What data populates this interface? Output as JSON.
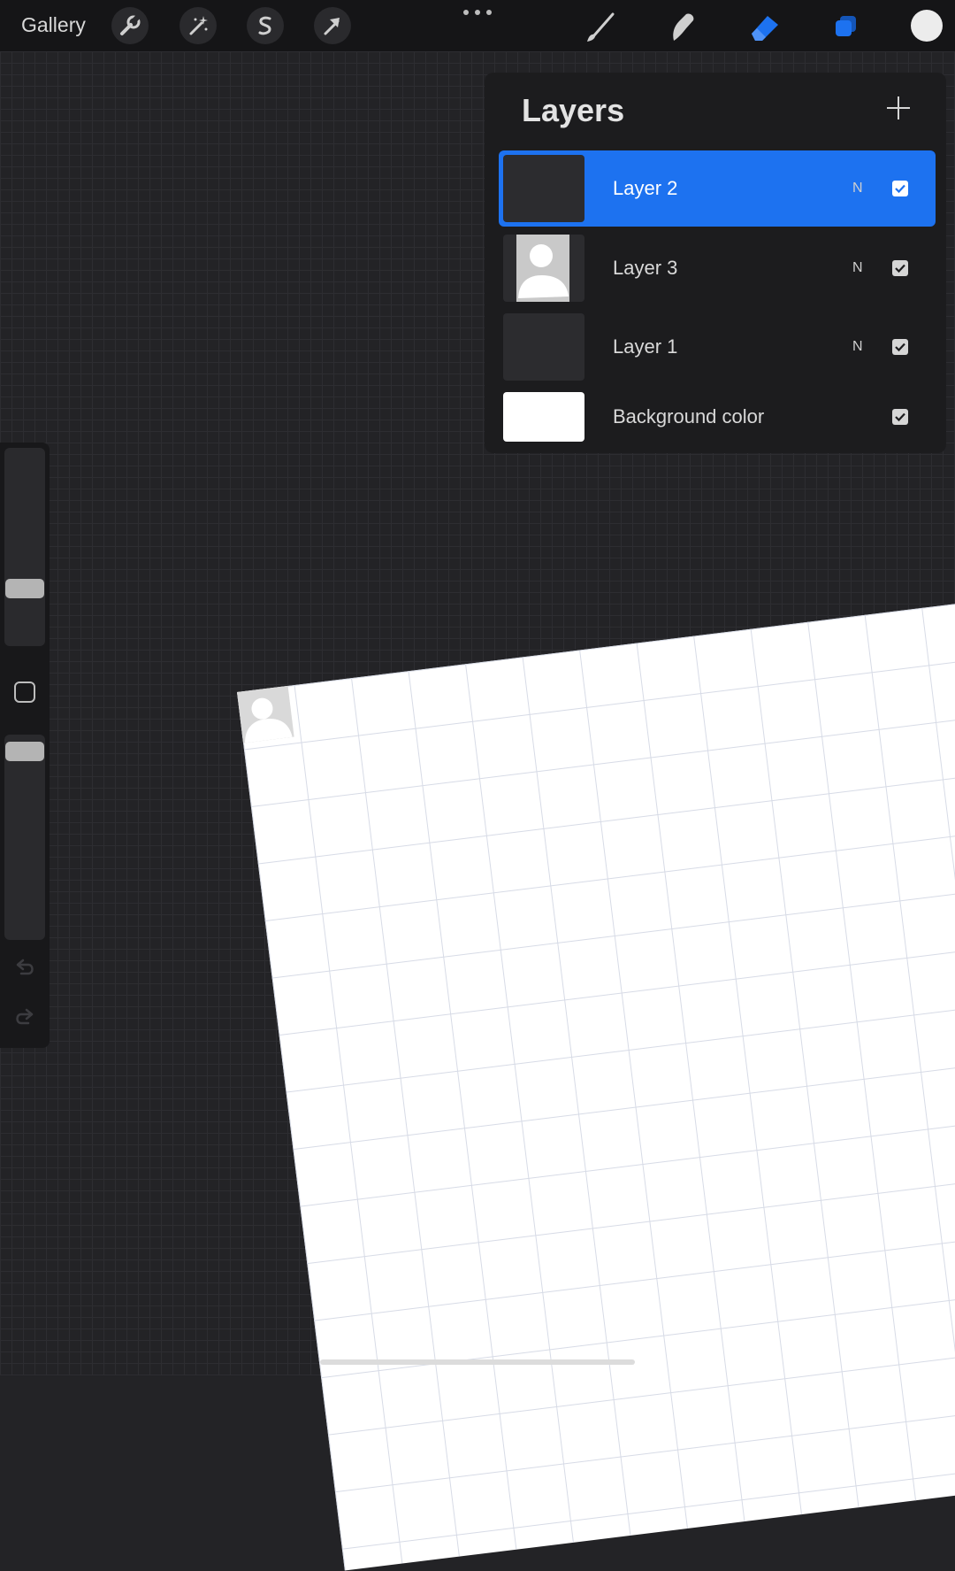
{
  "toolbar": {
    "gallery_label": "Gallery",
    "left_tools": [
      "wrench-icon",
      "magic-wand-icon",
      "selection-s-icon",
      "transform-arrow-icon"
    ],
    "right_tools": [
      "brush-icon",
      "smudge-icon",
      "eraser-icon",
      "layers-icon"
    ],
    "active_tool": "eraser-icon",
    "accent_color": "#1d72f0",
    "current_color": "#ececec"
  },
  "layers_panel": {
    "title": "Layers",
    "layers": [
      {
        "name": "Layer 2",
        "blend": "N",
        "visible": true,
        "selected": true,
        "thumbnail": "dark"
      },
      {
        "name": "Layer 3",
        "blend": "N",
        "visible": true,
        "selected": false,
        "thumbnail": "avatar"
      },
      {
        "name": "Layer 1",
        "blend": "N",
        "visible": true,
        "selected": false,
        "thumbnail": "dark"
      },
      {
        "name": "Background color",
        "blend": "",
        "visible": true,
        "selected": false,
        "thumbnail": "white"
      }
    ]
  },
  "sidebar": {
    "brush_size_level": 0.28,
    "opacity_level": 0.92
  }
}
